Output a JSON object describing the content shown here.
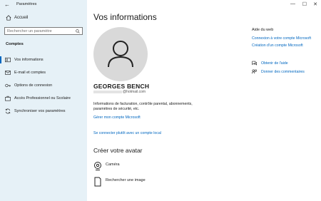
{
  "window": {
    "title": "Paramètres",
    "controls": {
      "minimize": "—",
      "maximize": "☐",
      "close": "✕"
    }
  },
  "sidebar": {
    "home_label": "Accueil",
    "search_placeholder": "Rechercher un paramètre",
    "section_label": "Comptes",
    "items": [
      {
        "label": "Vos informations",
        "icon": "person-card-icon",
        "active": true
      },
      {
        "label": "E-mail et comptes",
        "icon": "mail-icon",
        "active": false
      },
      {
        "label": "Options de connexion",
        "icon": "key-icon",
        "active": false
      },
      {
        "label": "Accès Professionnel ou Scolaire",
        "icon": "briefcase-icon",
        "active": false
      },
      {
        "label": "Synchroniser vos paramètres",
        "icon": "sync-icon",
        "active": false
      }
    ]
  },
  "main": {
    "title": "Vos informations",
    "user_name": "GEORGES BENCH",
    "email_domain": "@hotmail.com",
    "info_text": "Informations de facturation, contrôle parental, abonnements, paramètres de sécurité, etc.",
    "manage_link": "Gérer mon compte Microsoft",
    "local_link": "Se connecter plutôt avec un compte local",
    "avatar_heading": "Créer votre avatar",
    "avatar_options": [
      {
        "label": "Caméra",
        "icon": "camera-icon"
      },
      {
        "label": "Rechercher une image",
        "icon": "browse-image-icon"
      }
    ]
  },
  "right": {
    "help_title": "Aide du web",
    "help_links": [
      "Connexion à votre compte Microsoft",
      "Création d'un compte Microsoft"
    ],
    "get_help": "Obtenir de l'aide",
    "feedback": "Donner des commentaires"
  },
  "colors": {
    "sidebar_bg": "#e6f1f7",
    "accent": "#0067c0",
    "avatar_bg": "#d9d9d9"
  }
}
